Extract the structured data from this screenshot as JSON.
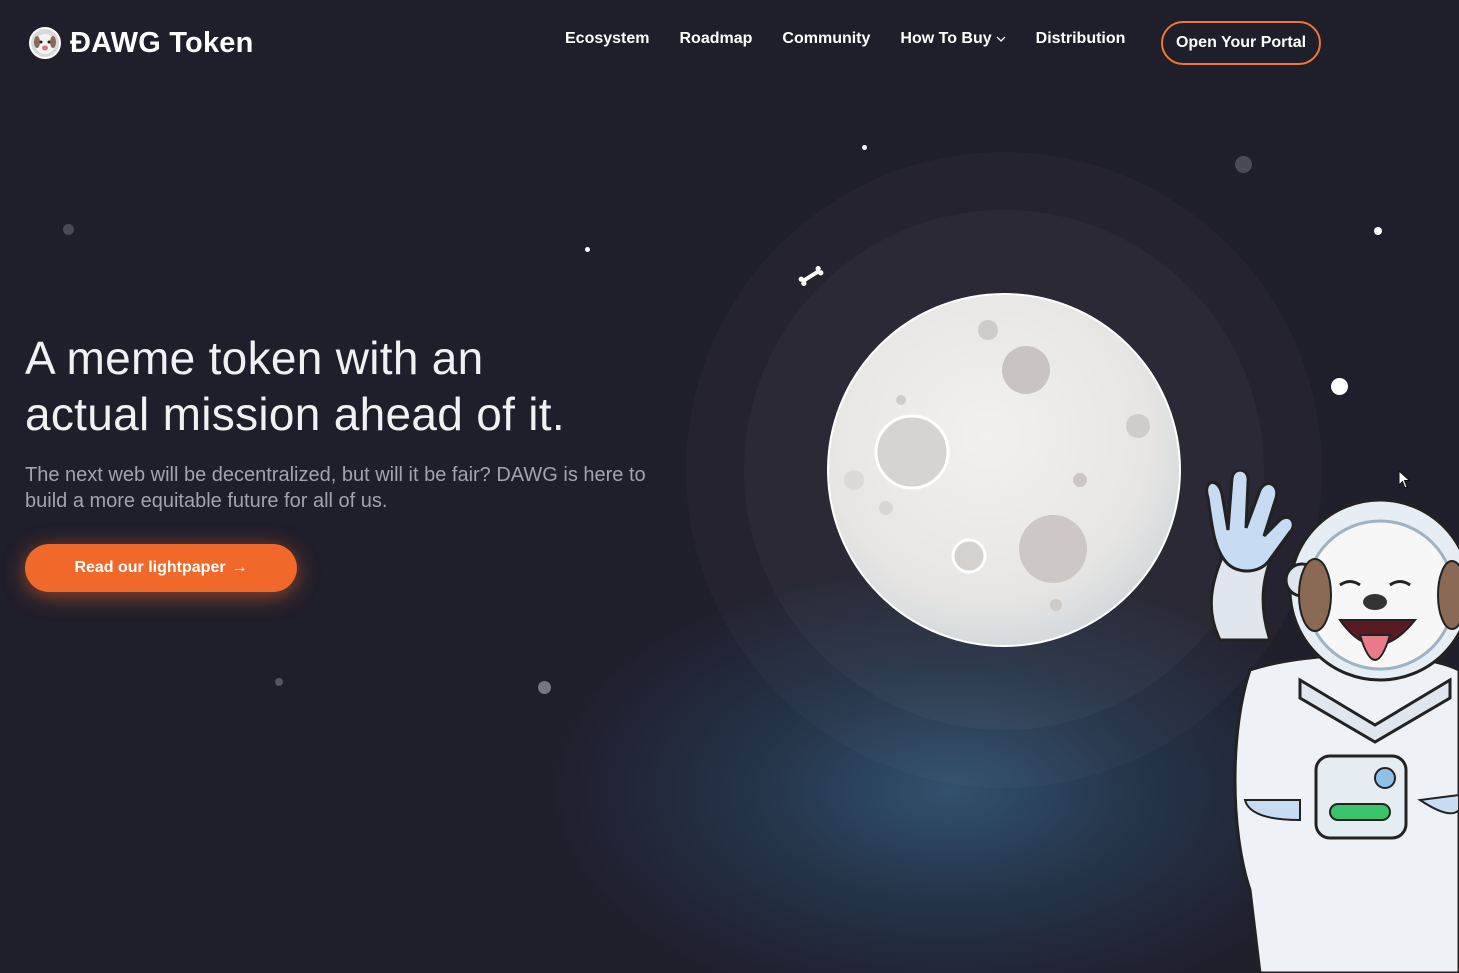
{
  "header": {
    "brand": "ĐAWG Token",
    "nav": [
      {
        "label": "Ecosystem"
      },
      {
        "label": "Roadmap"
      },
      {
        "label": "Community"
      },
      {
        "label": "How To Buy",
        "has_dropdown": true
      },
      {
        "label": "Distribution"
      }
    ],
    "portal_button": "Open Your Portal"
  },
  "hero": {
    "title_line1": "A meme token with an",
    "title_line2": "actual mission ahead of it.",
    "subtitle": "The next web will be decentralized, but will it be fair? DAWG is here to build a more equitable future for all of us.",
    "cta_label": "Read our lightpaper",
    "cta_arrow": "→"
  },
  "theme": {
    "background": "#1f1e2b",
    "accent": "#f0692a",
    "portal_border": "#f2772e",
    "subtitle_color": "#a3a3ad",
    "moon_color": "#efedeb"
  },
  "icons": {
    "logo": "dog-astronaut-logo-icon",
    "dropdown": "chevron-down-icon",
    "cta": "arrow-right-icon",
    "illustration": "dog-astronaut-illustration"
  }
}
